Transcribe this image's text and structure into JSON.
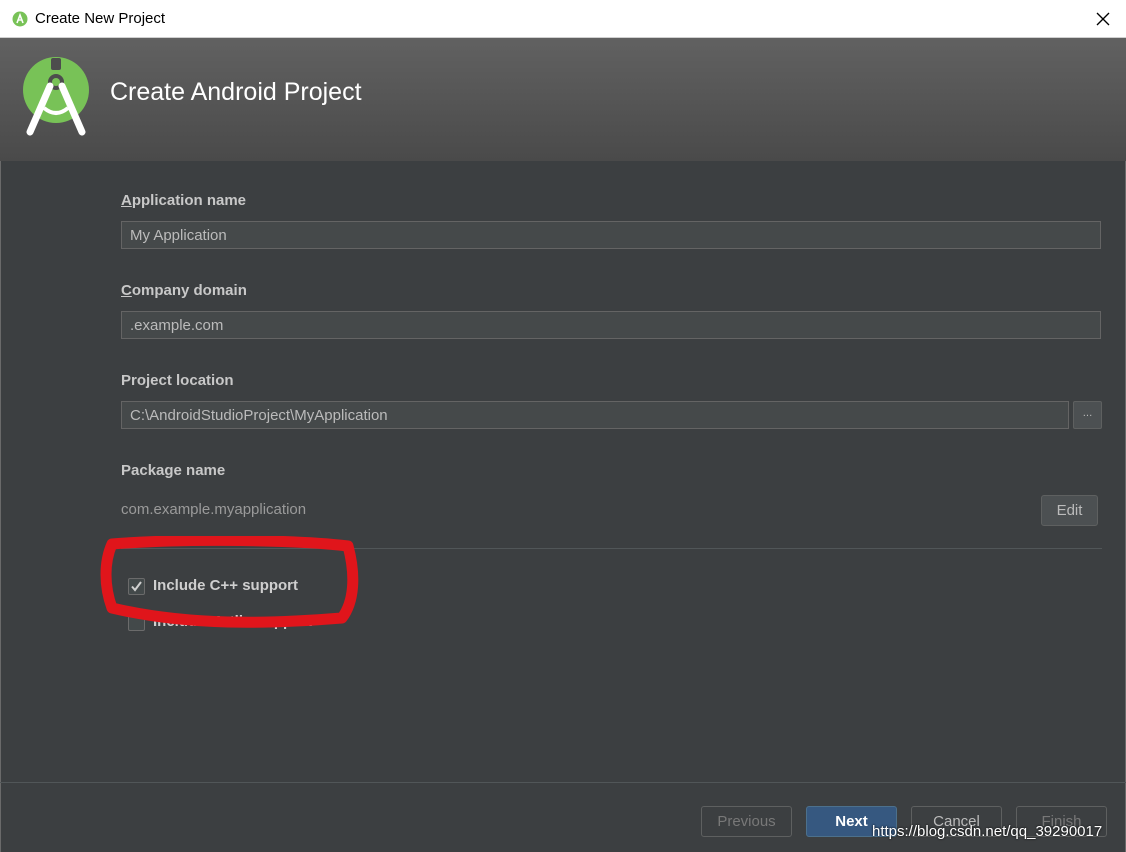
{
  "window": {
    "title": "Create New Project"
  },
  "header": {
    "title": "Create Android Project"
  },
  "form": {
    "app_name": {
      "label_first": "A",
      "label_rest": "pplication name",
      "value": "My Application"
    },
    "company_domain": {
      "label_first": "C",
      "label_rest": "ompany domain",
      "value": ".example.com"
    },
    "project_location": {
      "label": "Project location",
      "value": "C:\\AndroidStudioProject\\MyApplication",
      "browse_label": "..."
    },
    "package_name": {
      "label": "Package name",
      "value": "com.example.myapplication",
      "edit_label": "Edit"
    }
  },
  "options": {
    "cpp": {
      "label": "Include C++ support",
      "checked": true
    },
    "kotlin": {
      "label": "Include Kotlin support",
      "checked": false
    }
  },
  "footer": {
    "previous": "Previous",
    "next": "Next",
    "cancel": "Cancel",
    "finish": "Finish"
  },
  "watermark": "https://blog.csdn.net/qq_39290017",
  "colors": {
    "accent": "#365880",
    "annotation": "#e0151b",
    "android_green": "#78c257"
  },
  "icons": {
    "app": "android-studio-icon",
    "close": "close-icon",
    "check": "checkmark-icon"
  }
}
